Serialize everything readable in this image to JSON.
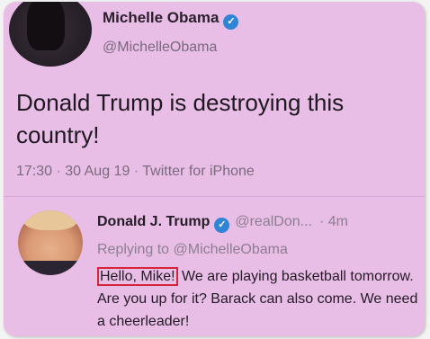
{
  "main_tweet": {
    "author_name": "Michelle Obama",
    "verified_badge": "✓",
    "handle": "@MichelleObama",
    "text": "Donald Trump is destroying this country!",
    "time": "17:30",
    "date": "30 Aug 19",
    "source": "Twitter for iPhone",
    "separator": " · "
  },
  "reply": {
    "author_name": "Donald J. Trump",
    "verified_badge": "✓",
    "handle": "@realDon...",
    "time_ago": "· 4m",
    "replying_to": "Replying to @MichelleObama",
    "highlighted_text": "Hello, Mike!",
    "body_text": "We are playing basketball tomorrow. Are you up for it? Barack can also come. We need a cheerleader!"
  },
  "colors": {
    "background": "#e8bde6",
    "verified": "#2f84d6",
    "highlight_box": "#d6243a"
  },
  "icons": [
    "verified-icon",
    "profile-avatar"
  ]
}
